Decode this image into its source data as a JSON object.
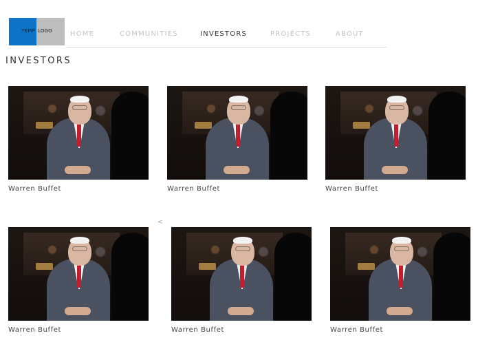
{
  "logo": {
    "part1": "TEMP",
    "part2": "LOGO",
    "colors": {
      "left": "#0f73c8",
      "right": "#bdbdbd"
    }
  },
  "nav": {
    "items": [
      {
        "label": "HOME",
        "active": false
      },
      {
        "label": "COMMUNITIES",
        "active": false
      },
      {
        "label": "INVESTORS",
        "active": true
      },
      {
        "label": "PROJECTS",
        "active": false
      },
      {
        "label": "ABOUT",
        "active": false
      }
    ]
  },
  "page": {
    "title": "INVESTORS"
  },
  "investors": [
    {
      "name": "Warren Buffet"
    },
    {
      "name": "Warren Buffet"
    },
    {
      "name": "Warren Buffet"
    },
    {
      "name": "Warren Buffet"
    },
    {
      "name": "Warren Buffet"
    },
    {
      "name": "Warren Buffet"
    }
  ],
  "pager": {
    "prev": "<"
  }
}
